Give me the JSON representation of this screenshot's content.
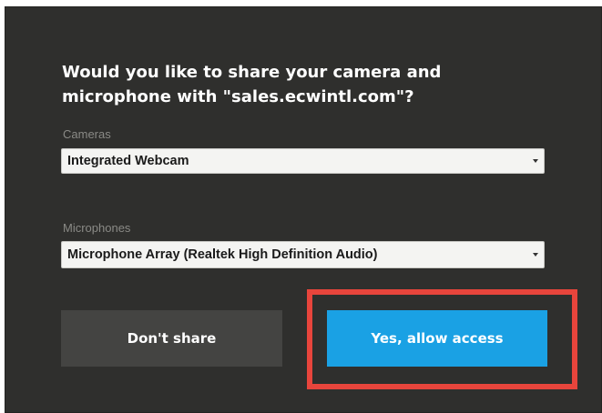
{
  "dialog": {
    "question": "Would you like to share your camera and microphone with \"sales.ecwintl.com\"?",
    "cameras": {
      "label": "Cameras",
      "selected": "Integrated Webcam"
    },
    "microphones": {
      "label": "Microphones",
      "selected": "Microphone Array (Realtek High Definition Audio)"
    },
    "buttons": {
      "deny": "Don't share",
      "allow": "Yes, allow access"
    }
  },
  "colors": {
    "dialog_background": "#2f2f2d",
    "deny_button": "#444442",
    "allow_button": "#1aa1e4",
    "highlight": "#e8453c"
  },
  "icons": {
    "select_arrow": "chevron-down-icon"
  }
}
